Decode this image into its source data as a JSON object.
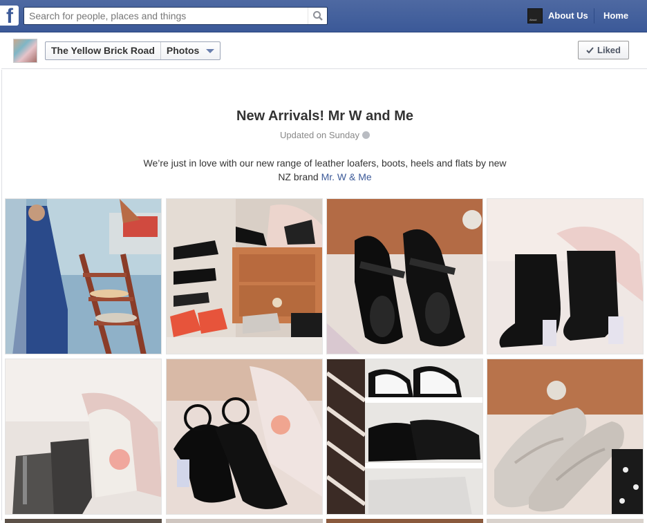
{
  "topbar": {
    "logo": "f",
    "search_placeholder": "Search for people, places and things",
    "avatar_text": "About",
    "about_label": "About Us",
    "home_label": "Home"
  },
  "pagebar": {
    "page_name": "The Yellow Brick Road",
    "section": "Photos",
    "liked_label": "Liked"
  },
  "album": {
    "title": "New Arrivals! Mr W and Me",
    "updated": "Updated on Sunday",
    "description": "We’re just in love with our new range of leather loafers, boots, heels and flats by new NZ brand ",
    "brand_link": "Mr. W & Me"
  },
  "colors": {
    "brand": "#3b5998",
    "link": "#3b5998"
  },
  "photos": [
    {
      "subject": "blue dress on mannequin and ladder with shoes"
    },
    {
      "subject": "shoes on wooden drawers"
    },
    {
      "subject": "black patent mary jane shoes"
    },
    {
      "subject": "black suede ankle boots"
    },
    {
      "subject": "grey speckled ankle boots with vase"
    },
    {
      "subject": "black patent ankle-strap heels"
    },
    {
      "subject": "black and white loafers on shelves"
    },
    {
      "subject": "grey patent loafers"
    }
  ]
}
